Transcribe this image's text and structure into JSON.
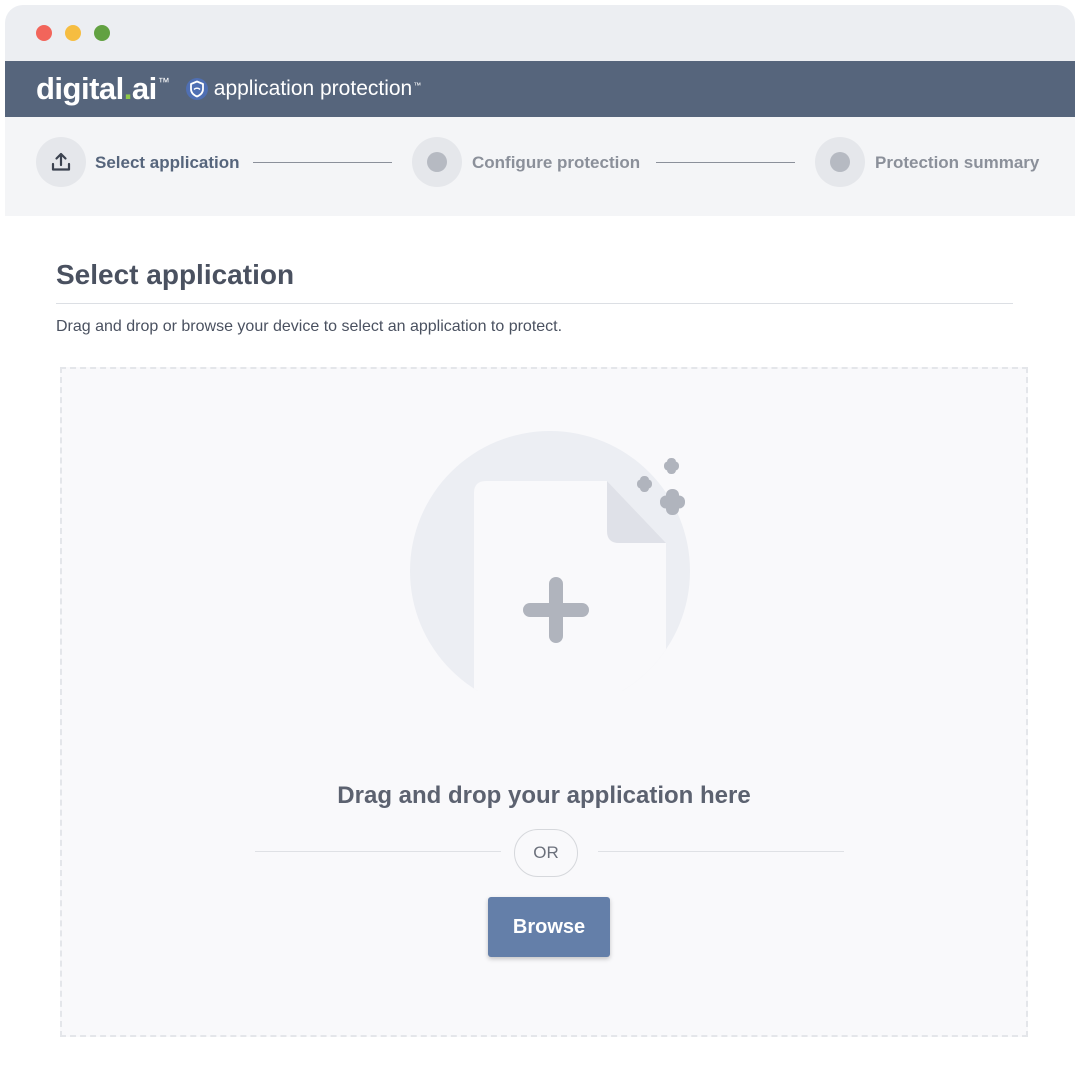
{
  "window": {
    "controls": [
      "close",
      "minimize",
      "maximize"
    ]
  },
  "header": {
    "brand_main": "digital",
    "brand_dot": ".",
    "brand_suffix": "ai",
    "brand_tm": "™",
    "product": "application protection",
    "product_tm": "™",
    "shield_icon": "shield-icon"
  },
  "stepper": {
    "steps": [
      {
        "label": "Select application",
        "icon": "upload-icon",
        "active": true
      },
      {
        "label": "Configure protection",
        "icon": "step-dot",
        "active": false
      },
      {
        "label": "Protection summary",
        "icon": "step-dot",
        "active": false
      }
    ]
  },
  "content": {
    "title": "Select application",
    "description": "Drag and drop or browse your device to select an application to protect."
  },
  "dropzone": {
    "illustration_icon": "add-file-icon",
    "heading": "Drag and drop your application here",
    "or_label": "OR",
    "browse_label": "Browse"
  },
  "colors": {
    "header_bg": "#56657c",
    "accent_button": "#647fa9",
    "brand_green": "#8fc848",
    "traffic_red": "#f2655b",
    "traffic_yellow": "#f6bd41",
    "traffic_green": "#62a142"
  }
}
